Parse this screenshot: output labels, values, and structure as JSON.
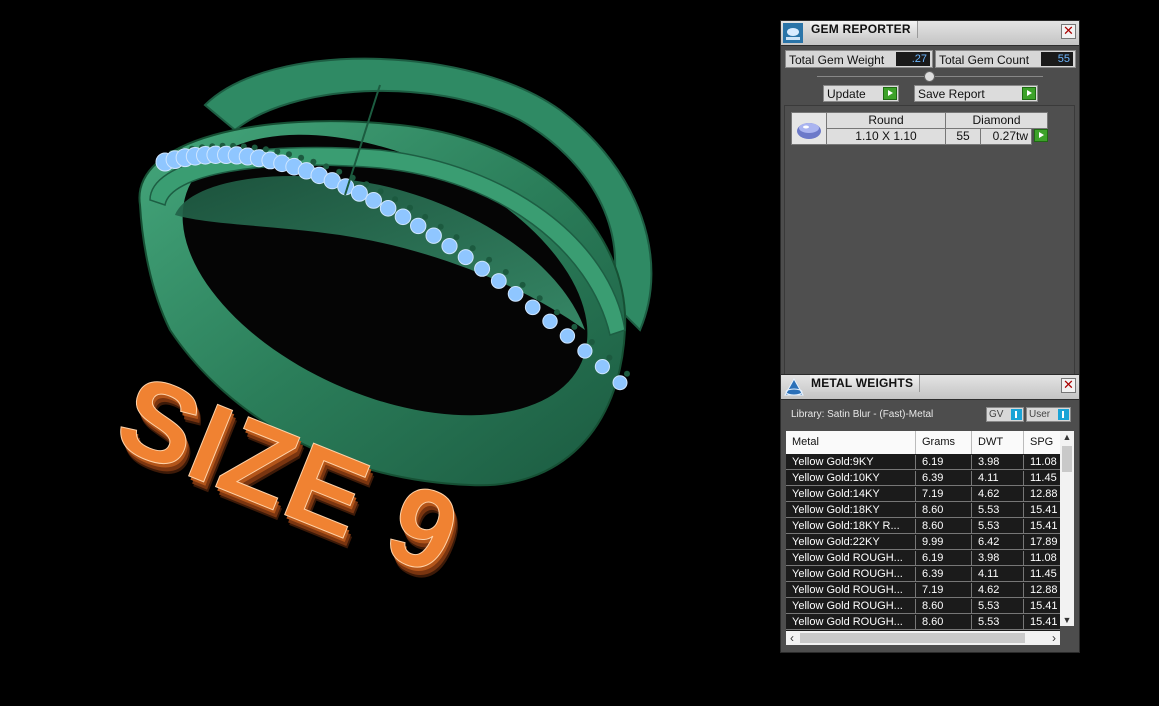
{
  "viewport": {
    "annotation_text": "SIZE 9"
  },
  "gem_reporter": {
    "title": "GEM REPORTER",
    "close_label": "✕",
    "total_gem_weight_label": "Total Gem Weight",
    "total_gem_weight_value": ".27",
    "total_gem_count_label": "Total Gem Count",
    "total_gem_count_value": "55",
    "update_label": "Update",
    "save_report_label": "Save Report",
    "gem": {
      "shape": "Round",
      "material": "Diamond",
      "size": "1.10 X 1.10",
      "count": "55",
      "weight": "0.27tw"
    }
  },
  "metal_weights": {
    "title": "METAL WEIGHTS",
    "close_label": "✕",
    "library": "Library: Satin Blur - (Fast)-Metal",
    "toggle_gv": "GV",
    "toggle_user": "User",
    "columns": [
      "Metal",
      "Grams",
      "DWT",
      "SPG"
    ],
    "rows": [
      [
        "Yellow Gold:9KY",
        "6.19",
        "3.98",
        "11.08"
      ],
      [
        "Yellow Gold:10KY",
        "6.39",
        "4.11",
        "11.45"
      ],
      [
        "Yellow Gold:14KY",
        "7.19",
        "4.62",
        "12.88"
      ],
      [
        "Yellow Gold:18KY",
        "8.60",
        "5.53",
        "15.41"
      ],
      [
        "Yellow Gold:18KY R...",
        "8.60",
        "5.53",
        "15.41"
      ],
      [
        "Yellow Gold:22KY",
        "9.99",
        "6.42",
        "17.89"
      ],
      [
        "Yellow Gold ROUGH...",
        "6.19",
        "3.98",
        "11.08"
      ],
      [
        "Yellow Gold ROUGH...",
        "6.39",
        "4.11",
        "11.45"
      ],
      [
        "Yellow Gold ROUGH...",
        "7.19",
        "4.62",
        "12.88"
      ],
      [
        "Yellow Gold ROUGH...",
        "8.60",
        "5.53",
        "15.41"
      ],
      [
        "Yellow Gold ROUGH...",
        "8.60",
        "5.53",
        "15.41"
      ]
    ],
    "scroll_up": "▲",
    "scroll_down": "▼",
    "scroll_left": "‹",
    "scroll_right": "›"
  },
  "colors": {
    "ring_green": "#2f8a64",
    "gem_blue": "#8fc6ff",
    "text_orange": "#f08232",
    "value_blue": "#6cb6ff",
    "go_green": "#3da22a"
  }
}
